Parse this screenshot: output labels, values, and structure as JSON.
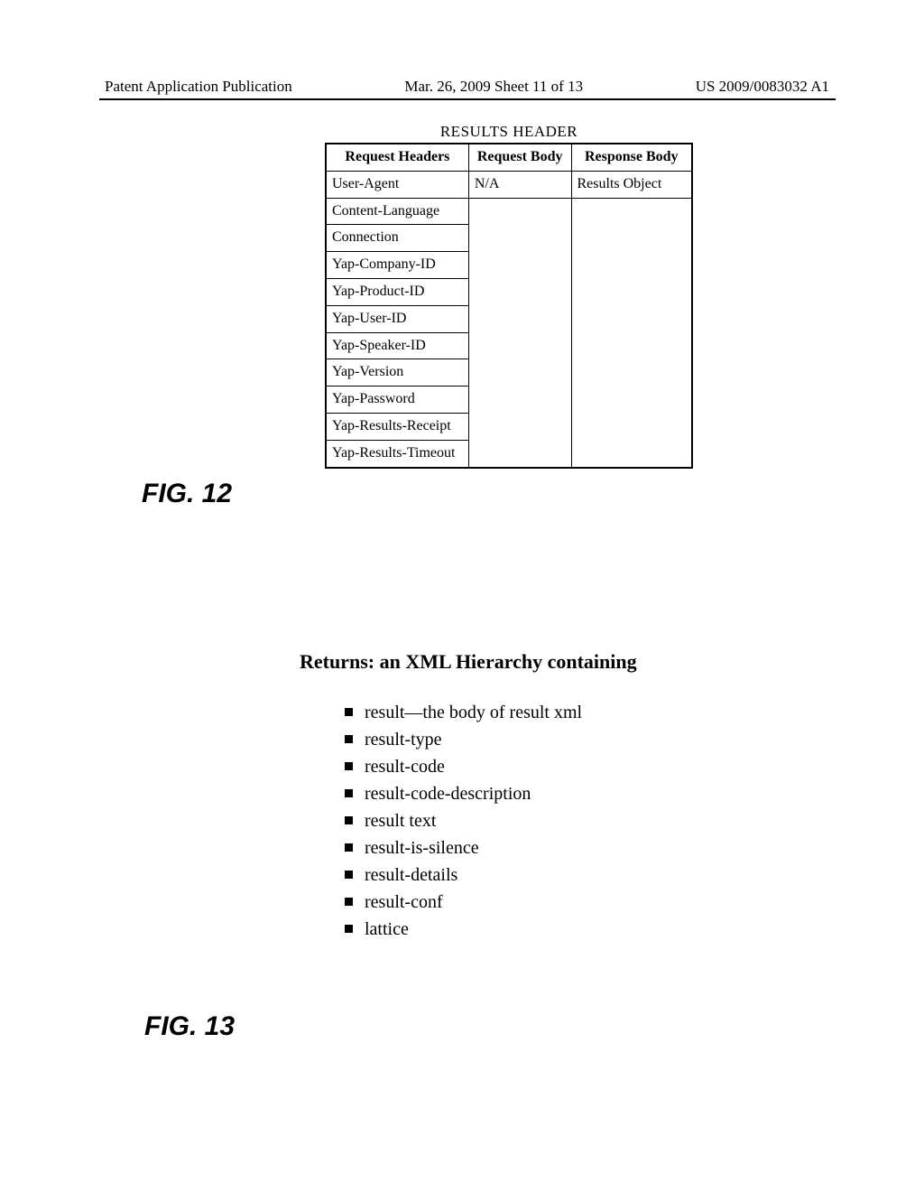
{
  "header": {
    "left": "Patent Application Publication",
    "middle": "Mar. 26, 2009  Sheet 11 of 13",
    "right": "US 2009/0083032 A1"
  },
  "figure12": {
    "title": "RESULTS HEADER",
    "label": "FIG. 12",
    "columns": [
      "Request Headers",
      "Request Body",
      "Response Body"
    ],
    "rows": [
      {
        "h": "User-Agent",
        "b": "N/A",
        "r": "Results Object"
      },
      {
        "h": "Content-Language",
        "b": "",
        "r": ""
      },
      {
        "h": "Connection",
        "b": "",
        "r": ""
      },
      {
        "h": "Yap-Company-ID",
        "b": "",
        "r": ""
      },
      {
        "h": "Yap-Product-ID",
        "b": "",
        "r": ""
      },
      {
        "h": "Yap-User-ID",
        "b": "",
        "r": ""
      },
      {
        "h": "Yap-Speaker-ID",
        "b": "",
        "r": ""
      },
      {
        "h": "Yap-Version",
        "b": "",
        "r": ""
      },
      {
        "h": "Yap-Password",
        "b": "",
        "r": ""
      },
      {
        "h": "Yap-Results-Receipt",
        "b": "",
        "r": ""
      },
      {
        "h": "Yap-Results-Timeout",
        "b": "",
        "r": ""
      }
    ]
  },
  "figure13": {
    "label": "FIG. 13",
    "returns_title": "Returns: an XML Hierarchy containing",
    "items": [
      "result—the body of result xml",
      "result-type",
      "result-code",
      "result-code-description",
      "result text",
      "result-is-silence",
      "result-details",
      "result-conf",
      "lattice"
    ]
  }
}
